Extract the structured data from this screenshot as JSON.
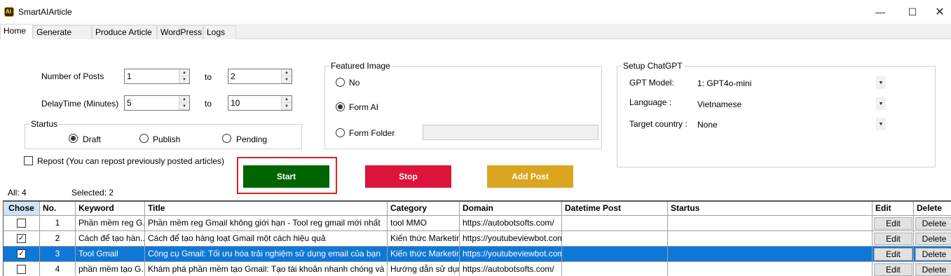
{
  "window": {
    "title": "SmartAIArticle",
    "icon_text": "AI"
  },
  "tabs": [
    {
      "label": "Home"
    },
    {
      "label": "Generate Title"
    },
    {
      "label": "Produce Article"
    },
    {
      "label": "WordPress"
    },
    {
      "label": "Logs"
    }
  ],
  "form": {
    "num_posts_label": "Number of Posts",
    "num_posts_from": "1",
    "num_posts_to": "2",
    "delay_label": "DelayTime (Minutes)",
    "delay_from": "5",
    "delay_to": "10",
    "to_label": "to"
  },
  "status_group": {
    "legend": "Startus",
    "options": [
      "Draft",
      "Publish",
      "Pending"
    ],
    "selected": "Draft"
  },
  "repost": {
    "label": "Repost (You can repost previously posted articles)",
    "checked": false
  },
  "featured_image": {
    "legend": "Featured Image",
    "options": [
      "No",
      "Form AI",
      "Form Folder"
    ],
    "selected": "Form AI",
    "folder_path": ""
  },
  "chatgpt": {
    "legend": "Setup ChatGPT",
    "model_label": "GPT Model:",
    "model_value": "1: GPT4o-mini",
    "language_label": "Language :",
    "language_value": "Vietnamese",
    "country_label": "Target country :",
    "country_value": "None"
  },
  "actions": {
    "start": "Start",
    "stop": "Stop",
    "add_post": "Add Post"
  },
  "counts": {
    "all": "All: 4",
    "selected": "Selected: 2"
  },
  "table": {
    "headers": [
      "Chose",
      "No.",
      "Keyword",
      "Title",
      "Category",
      "Domain",
      "Datetime Post",
      "Startus",
      "Edit",
      "Delete"
    ],
    "edit_label": "Edit",
    "delete_label": "Delete",
    "rows": [
      {
        "checked": false,
        "no": "1",
        "keyword": "Phần mềm reg G...",
        "title": "Phần mềm reg Gmail không giới hạn - Tool reg gmail mới nhất",
        "category": "tool MMO",
        "domain": "https://autobotsofts.com/",
        "datetime": "",
        "status": ""
      },
      {
        "checked": true,
        "no": "2",
        "keyword": "Cách để tạo hàn...",
        "title": "Cách để tạo hàng loạt Gmail một cách hiệu quả",
        "category": "Kiến thức Marketing",
        "domain": "https://youtubeviewbot.com",
        "datetime": "",
        "status": ""
      },
      {
        "checked": true,
        "no": "3",
        "keyword": "Tool Gmail",
        "title": "Công cụ Gmail: Tối ưu hóa trải nghiệm sử dụng email của bạn",
        "category": "Kiến thức Marketing",
        "domain": "https://youtubeviewbot.com",
        "datetime": "",
        "status": ""
      },
      {
        "checked": false,
        "no": "4",
        "keyword": "phần mềm tạo G...",
        "title": "Khám phá phần mềm tạo Gmail: Tạo tài khoản nhanh chóng và dễ d...",
        "category": "Hướng dẫn sử dụng",
        "domain": "https://autobotsofts.com/",
        "datetime": "",
        "status": ""
      }
    ]
  },
  "colors": {
    "start": "#006400",
    "stop": "#dc143c",
    "add_post": "#daa520",
    "highlight": "#e02020",
    "selection": "#0f78d7"
  }
}
